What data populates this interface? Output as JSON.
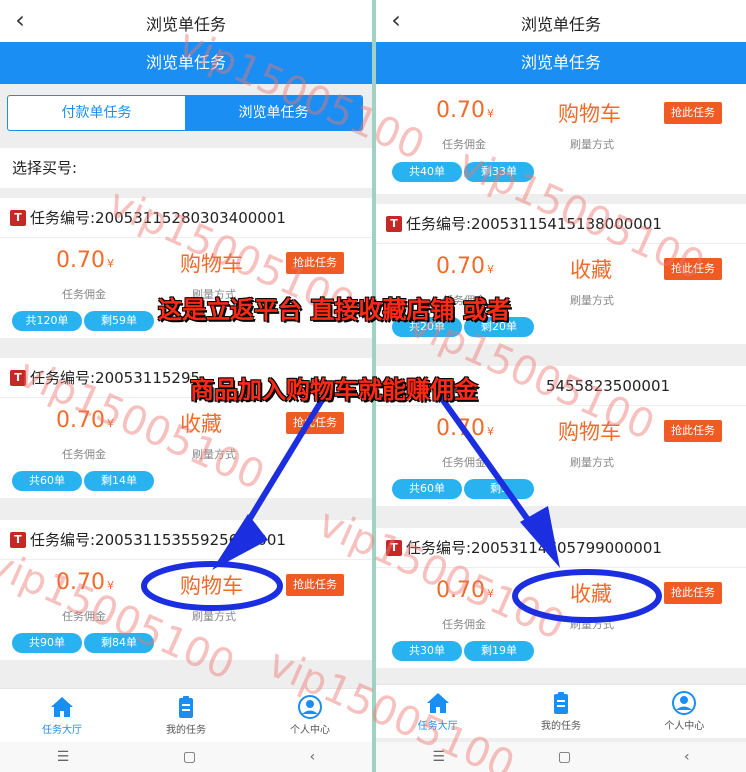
{
  "header": {
    "title": "浏览单任务",
    "back_icon": "chevron-left-icon"
  },
  "banner": {
    "title": "浏览单任务"
  },
  "segment": {
    "tab1": "付款单任务",
    "tab2": "浏览单任务"
  },
  "select_row": {
    "label": "选择买号:"
  },
  "labels": {
    "commission": "任务佣金",
    "method": "刷量方式",
    "grab_button": "抢此任务",
    "currency": "¥"
  },
  "left_tasks": [
    {
      "id": "任务编号:2005311528030340000​1",
      "price": "0.70",
      "method": "购物车",
      "total": "共120单",
      "remaining": "剩59单"
    },
    {
      "id": "任务编号:20053115295",
      "price": "0.70",
      "method": "收藏",
      "total": "共60单",
      "remaining": "剩14单"
    },
    {
      "id": "任务编号:20053115355925600001",
      "price": "0.70",
      "method": "购物车",
      "total": "共90单",
      "remaining": "剩84单"
    }
  ],
  "right_tasks": [
    {
      "id": "",
      "price": "0.70",
      "method": "购物车",
      "total": "共40单",
      "remaining": "剩33单"
    },
    {
      "id": "任务编号:20053115415138000001",
      "price": "0.70",
      "method": "收藏",
      "total": "共20单",
      "remaining": "剩20单"
    },
    {
      "id": "5455823500001",
      "price": "0.70",
      "method": "购物车",
      "total": "共60单",
      "remaining": "剩5"
    },
    {
      "id": "任务编号:20053114705799000001",
      "price": "0.70",
      "method": "收藏",
      "total": "共30单",
      "remaining": "剩19单"
    }
  ],
  "tabbar": [
    {
      "label": "任务大厅",
      "icon": "home-icon"
    },
    {
      "label": "我的任务",
      "icon": "clipboard-icon"
    },
    {
      "label": "个人中心",
      "icon": "user-icon"
    }
  ],
  "overlay": {
    "line1": "这是立返平台 直接收藏店铺  或者",
    "line2": "商品加入购物车就能赚佣金"
  },
  "watermark": "vip15005100",
  "colors": {
    "primary": "#1a8ef3",
    "accent": "#f26b2b",
    "button": "#ef5b22",
    "pill": "#28b3f0",
    "annotation": "#1b2fe0"
  }
}
